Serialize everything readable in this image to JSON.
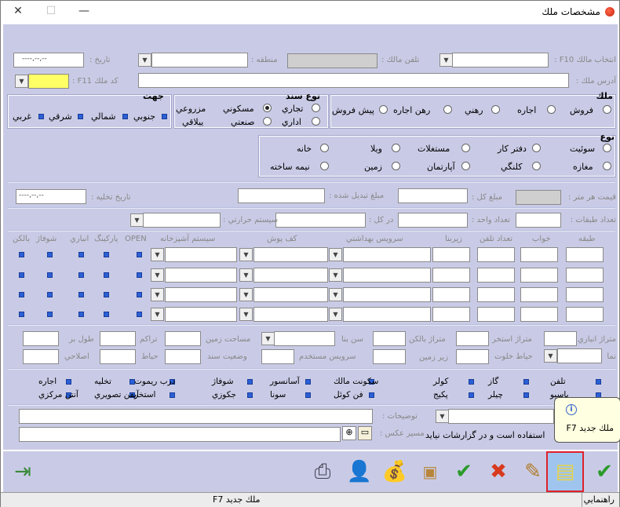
{
  "window": {
    "title": "مشخصات ملك",
    "close": "✕",
    "maximize": "☐",
    "minimize": "—"
  },
  "row1": {
    "f10_label": "انتخاب مالك F10 :",
    "owner_phone_label": "تلفن مالك :",
    "region_label": "منطقه :",
    "date_label": "تاريخ :",
    "date_value": "----,--,--"
  },
  "row2": {
    "address_label": "آدرس ملك :",
    "code_label": "كد ملك F11 :"
  },
  "melk": {
    "title": "ملك",
    "options": [
      "فروش",
      "اجاره",
      "رهني",
      "رهن اجاره",
      "پيش فروش"
    ]
  },
  "sanad": {
    "title": "نوع سند",
    "options": [
      "تجاري",
      "مسكوني",
      "مزروعي",
      "اداري",
      "صنعتي",
      "ييلاقي"
    ]
  },
  "jahat": {
    "title": "جهت",
    "options": [
      "جنوبي",
      "شمالي",
      "شرقي",
      "غربي"
    ]
  },
  "noe": {
    "title": "نوع",
    "options": [
      "سوئيت",
      "دفتر كار",
      "مستغلات",
      "ويلا",
      "خانه",
      "مغازه",
      "كلنگي",
      "آپارتمان",
      "زمين",
      "نيمه ساخته"
    ]
  },
  "prices": {
    "meter_label": "قيمت هر متر :",
    "total_label": "مبلغ كل :",
    "converted_label": "مبلغ تبديل شده :",
    "evac_label": "تاريخ تخليه :",
    "evac_value": "----,--,--"
  },
  "floors": {
    "count_label": "تعداد طبقات :",
    "units_label": "تعداد واحد :",
    "per_floor_label": "در كل :",
    "heating_label": "سيستم حرارتي :"
  },
  "grid": {
    "headers": [
      "طبقه",
      "خواب",
      "تعداد تلفن",
      "زيربنا",
      "سرويس بهداشتي",
      "كف پوش",
      "سيستم آشپزخانه",
      "OPEN",
      "پاركينگ",
      "انباري",
      "شوفاژ",
      "بالكن"
    ]
  },
  "details": {
    "labels": [
      "متراژ انباري",
      "متراژ استخر",
      "متراژ بالكن",
      "سن بنا",
      "مساحت زمين",
      "تراكم",
      "طول بر",
      "نما",
      "حياط خلوت",
      "زير زمين",
      "سرويس مستخدم",
      "وضعيت سند",
      "حياط",
      "اصلاحي"
    ]
  },
  "amenities": {
    "items": [
      "تلفن",
      "گاز",
      "كولر",
      "سكونت مالك",
      "آسانسور",
      "شوفاژ",
      "درب ريموت",
      "تخليه",
      "اجاره",
      "پاسيو",
      "چيلر",
      "پكيج",
      "فن كوئل",
      "سونا",
      "جكوزي",
      "استخر",
      "آيفن تصويري",
      "آنتن مركزي"
    ]
  },
  "notes": {
    "desc_label": "توضيحات :",
    "image_label": "مسير عكس :",
    "hidden_text": "استفاده است و در گزارشات نيايد"
  },
  "tooltip": {
    "title": "ملك جديد F7",
    "icon": "i"
  },
  "status": {
    "help": "راهنمايي",
    "text": "ملك جديد F7"
  }
}
